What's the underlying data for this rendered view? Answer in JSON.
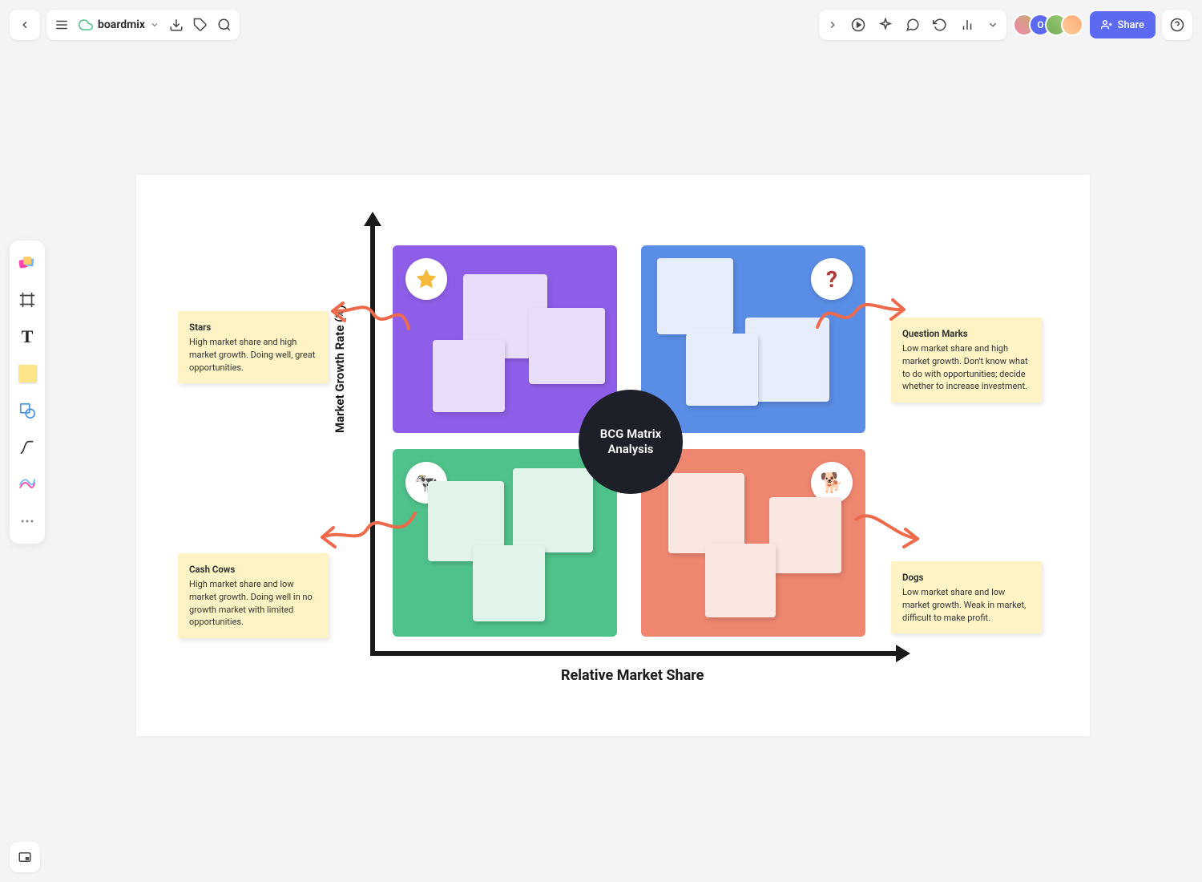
{
  "app": {
    "name": "boardmix",
    "share_label": "Share"
  },
  "diagram": {
    "center_title": "BCG Matrix Analysis",
    "x_label": "Relative Market Share",
    "y_label": "Market Growth Rate (%)",
    "stars": {
      "title": "Stars",
      "desc": "High market share and high market growth. Doing well, great opportunities."
    },
    "question_marks": {
      "title": "Question Marks",
      "desc": "Low market share and high market growth. Don't know what to do with opportunities; decide whether to increase investment."
    },
    "cash_cows": {
      "title": "Cash Cows",
      "desc": "High market share and low market growth. Doing well in no growth market with limited opportunities."
    },
    "dogs": {
      "title": "Dogs",
      "desc": "Low market share and low market growth. Weak in market, difficult to make profit."
    }
  }
}
